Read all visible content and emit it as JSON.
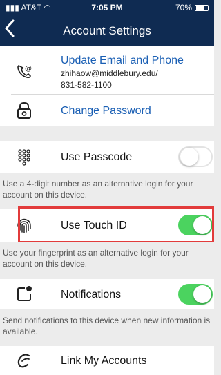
{
  "status_bar": {
    "carrier": "AT&T",
    "time": "7:05 PM",
    "battery": "70%",
    "battery_level": 0.7
  },
  "nav": {
    "back_icon": "chevron-left-icon",
    "title": "Account Settings"
  },
  "account": {
    "update_title": "Update Email and Phone",
    "email": "zhihaow@middlebury.edu/",
    "phone": "831-582-1100",
    "change_password": "Change Password"
  },
  "passcode": {
    "label": "Use Passcode",
    "enabled": false,
    "hint": "Use a 4-digit number as an alternative login for your account on this device."
  },
  "touch_id": {
    "label": "Use Touch ID",
    "enabled": true,
    "hint": "Use your fingerprint as an alternative login for your account on this device."
  },
  "notifications": {
    "label": "Notifications",
    "enabled": true,
    "hint": "Send notifications to this device when new information is available."
  },
  "link_accounts": {
    "label": "Link My Accounts"
  },
  "colors": {
    "nav": "#0f2b52",
    "link": "#1a5fb4",
    "toggle_on": "#4bd35f",
    "highlight": "#e23b3b"
  }
}
